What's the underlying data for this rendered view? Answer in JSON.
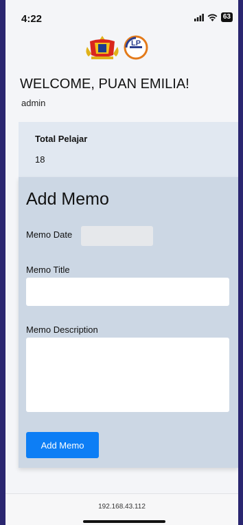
{
  "status_bar": {
    "time": "4:22",
    "battery": "63"
  },
  "header": {
    "welcome": "WELCOME, PUAN EMILIA!",
    "role": "admin"
  },
  "summary": {
    "label": "Total Pelajar",
    "value": "18"
  },
  "memo_form": {
    "heading": "Add Memo",
    "date_label": "Memo Date",
    "date_value": "",
    "title_label": "Memo Title",
    "title_value": "",
    "description_label": "Memo Description",
    "description_value": "",
    "submit_label": "Add Memo"
  },
  "browser": {
    "url": "192.168.43.112"
  },
  "colors": {
    "accent": "#0d7ef5",
    "panel": "#ccd7e4",
    "summary_card": "#e1e8f1",
    "device_frame": "#2a2670"
  }
}
